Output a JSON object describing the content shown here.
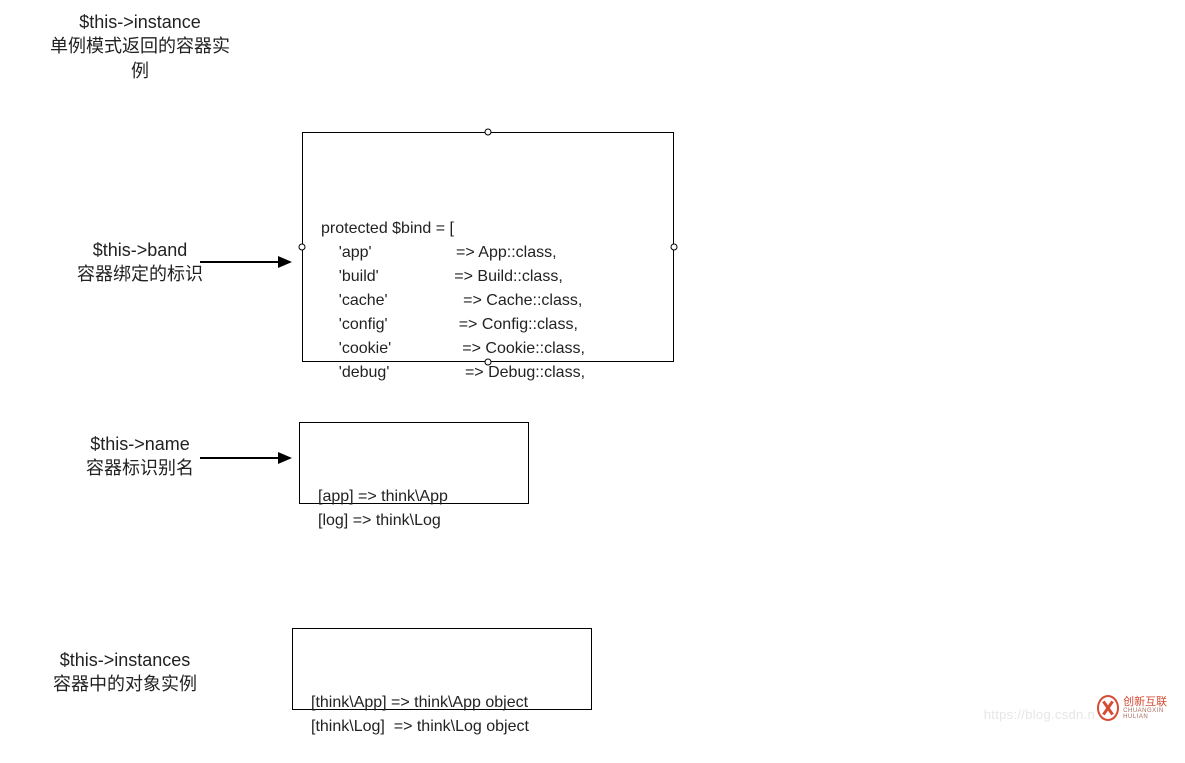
{
  "labels": {
    "instance": {
      "title": "$this->instance",
      "sub": "单例模式返回的容器实\n例"
    },
    "bind": {
      "title": "$this->band",
      "sub": "容器绑定的标识"
    },
    "name": {
      "title": "$this->name",
      "sub": "容器标识别名"
    },
    "instances": {
      "title": "$this->instances",
      "sub": "容器中的对象实例"
    }
  },
  "boxes": {
    "bind_code": "protected $bind = [\n    'app'                   => App::class,\n    'build'                 => Build::class,\n    'cache'                 => Cache::class,\n    'config'                => Config::class,\n    'cookie'                => Cookie::class,\n    'debug'                 => Debug::class,",
    "name_code": "[app] => think\\App\n[log] => think\\Log",
    "instances_code": "[think\\App] => think\\App object\n[think\\Log]  => think\\Log object"
  },
  "watermark": "https://blog.csdn.n",
  "logo": {
    "brand": "创新互联",
    "tag": "CHUANGXIN HULIAN"
  }
}
